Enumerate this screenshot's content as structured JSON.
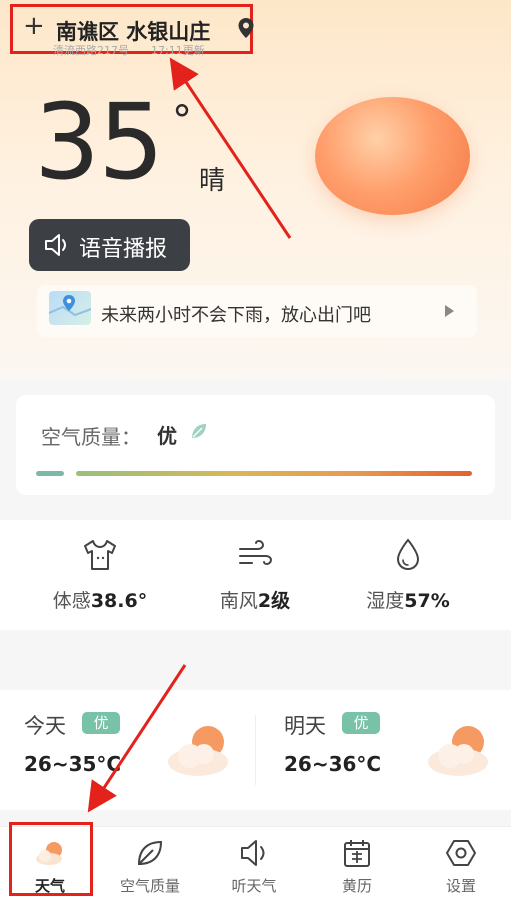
{
  "header": {
    "add_label": "+",
    "location": "南谯区 水银山庄",
    "address": "清流西路217号",
    "update_time": "17:11更新"
  },
  "current": {
    "temperature": "35",
    "degree_symbol": "°",
    "condition": "晴"
  },
  "voice": {
    "label": "语音播报"
  },
  "rain_notice": {
    "text": "未来两小时不会下雨，放心出门吧"
  },
  "air_quality": {
    "label": "空气质量：",
    "value": "优"
  },
  "stats": [
    {
      "label": "体感",
      "value": "38.6°",
      "icon": "tshirt-icon"
    },
    {
      "label": "南风",
      "value": "2级",
      "icon": "wind-icon"
    },
    {
      "label": "湿度",
      "value": "57%",
      "icon": "water-drop-icon"
    }
  ],
  "forecast": [
    {
      "day": "今天",
      "quality": "优",
      "range": "26~35°C"
    },
    {
      "day": "明天",
      "quality": "优",
      "range": "26~36°C"
    }
  ],
  "tabs": [
    {
      "label": "天气",
      "icon": "weather-icon"
    },
    {
      "label": "空气质量",
      "icon": "leaf-icon"
    },
    {
      "label": "听天气",
      "icon": "speaker-icon"
    },
    {
      "label": "黄历",
      "icon": "calendar-icon"
    },
    {
      "label": "设置",
      "icon": "settings-icon"
    }
  ],
  "colors": {
    "accent_green": "#78c2a7",
    "highlight_red": "#e3221c",
    "sun_orange": "#f47a45"
  }
}
